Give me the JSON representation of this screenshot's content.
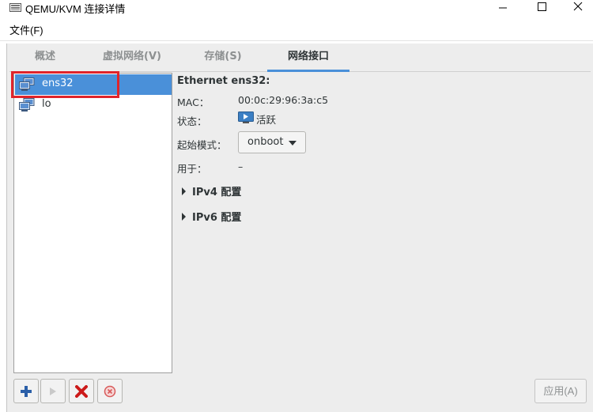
{
  "window": {
    "title": "QEMU/KVM 连接详情",
    "app_icon": "virt-manager-icon"
  },
  "menu": {
    "file": "文件(F)"
  },
  "tabs": [
    {
      "label": "概述",
      "active": false
    },
    {
      "label": "虚拟网络(V)",
      "active": false
    },
    {
      "label": "存储(S)",
      "active": false
    },
    {
      "label": "网络接口",
      "active": true
    }
  ],
  "interfaces": [
    {
      "name": "ens32",
      "selected": true,
      "icon": "network-interface-icon"
    },
    {
      "name": "lo",
      "selected": false,
      "icon": "network-interface-icon"
    }
  ],
  "details": {
    "title": "Ethernet ens32:",
    "mac_label": "MAC：",
    "mac_value": "00:0c:29:96:3a:c5",
    "state_label": "状态：",
    "state_value": "活跃",
    "state_icon": "state-running-icon",
    "start_mode_label": "起始模式：",
    "start_mode_value": "onboot",
    "used_by_label": "用于：",
    "used_by_value": "–",
    "ipv4_label": "IPv4 配置",
    "ipv6_label": "IPv6 配置"
  },
  "buttons": {
    "apply": "应用(A)"
  },
  "colors": {
    "selection": "#4a90d9",
    "highlight": "#e0242b",
    "tab_indicator": "#4a90d9"
  }
}
